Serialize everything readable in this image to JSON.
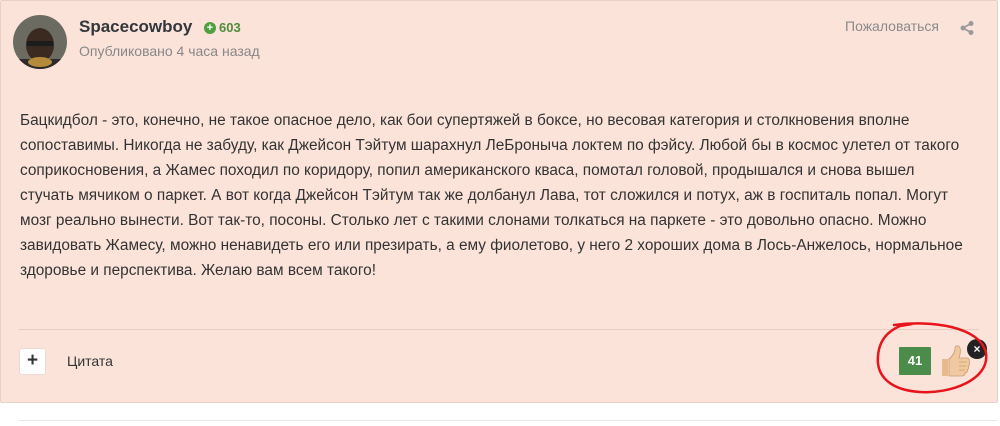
{
  "post": {
    "author": "Spacecowboy",
    "reputation": "603",
    "published": "Опубликовано 4 часа назад",
    "report_label": "Пожаловаться",
    "body": [
      "Бацкидбол - это, конечно, не такое опасное дело, как бои супертяжей в боксе, но весовая категория и столкновения вполне сопоставимы. Никогда не забуду, как Джейсон Тэйтум шарахнул ЛеБроныча локтем по фэйсу. Любой бы в космос улетел от такого соприкосновения, а Жамес походил по коридору, попил американского кваса, помотал головой, продышался и снова вышел стучать мячиком о паркет. А вот когда Джейсон Тэйтум так же долбанул Лава, тот сложился и потух, аж в госпиталь попал. Могут мозг реально вынести. Вот так-то, посоны. Столько лет с такими слонами толкаться на паркете - это довольно опасно. Можно завидовать Жамесу, можно ненавидеть его или презирать, а ему фиолетово, у него 2 хороших дома в Лось-Анжелось, нормальное здоровье и перспектива. Желаю вам всем такого!"
    ],
    "actions": {
      "plus_glyph": "+",
      "quote_label": "Цитата",
      "likes_count": "41",
      "close_glyph": "×"
    }
  },
  "colors": {
    "card_bg": "#fbe3da",
    "reputation_green": "#4f8c3c",
    "likes_badge": "#4c8c4a",
    "annotation_red": "#e8141b"
  },
  "icons": [
    "share-icon",
    "thumbs-up-icon",
    "close-icon",
    "plus-icon"
  ]
}
